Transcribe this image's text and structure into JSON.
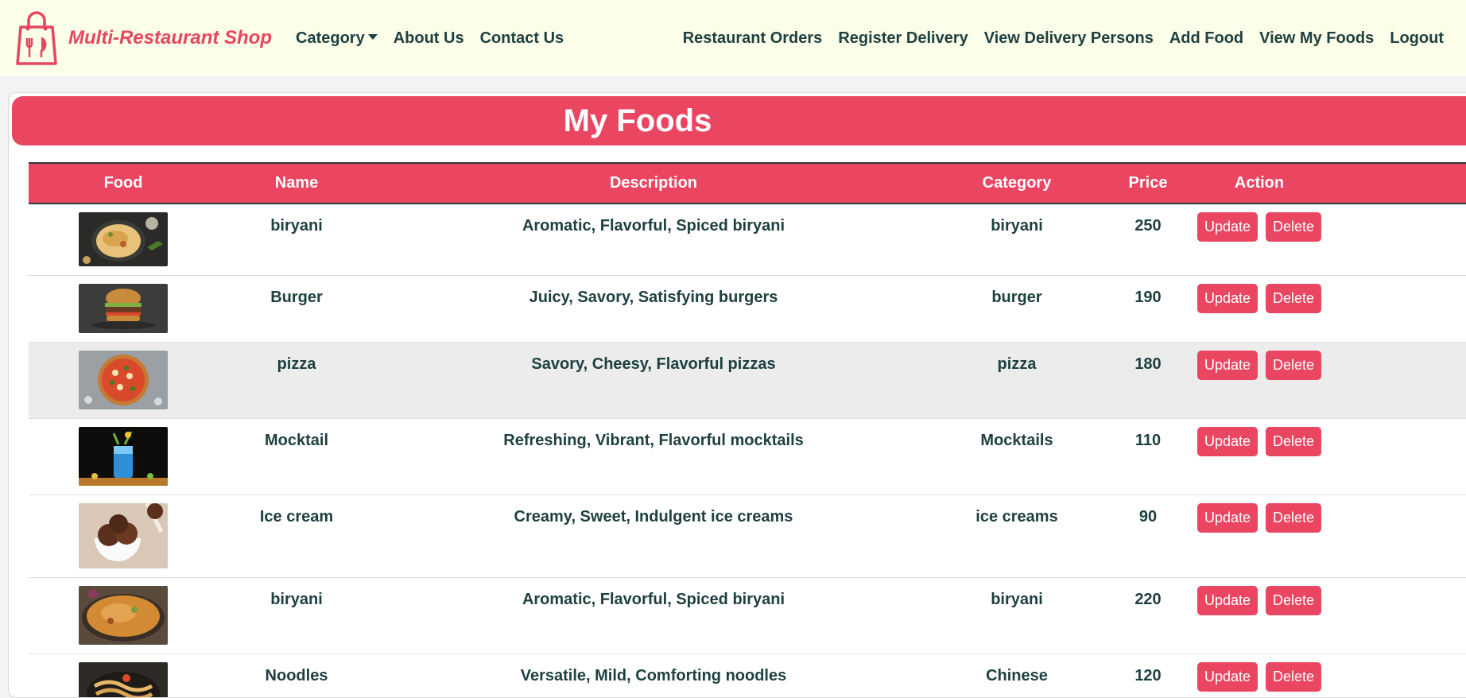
{
  "brand": {
    "name": "Multi-Restaurant Shop"
  },
  "nav": {
    "left": [
      "Category",
      "About Us",
      "Contact Us"
    ],
    "right": [
      "Restaurant Orders",
      "Register Delivery",
      "View Delivery Persons",
      "Add Food",
      "View My Foods",
      "Logout"
    ]
  },
  "page": {
    "title": "My Foods"
  },
  "table": {
    "headers": [
      "Food",
      "Name",
      "Description",
      "Category",
      "Price",
      "Action"
    ],
    "rows": [
      {
        "name": "biryani",
        "description": "Aromatic, Flavorful, Spiced biryani",
        "category": "biryani",
        "price": "250",
        "image": "biryani-image"
      },
      {
        "name": "Burger",
        "description": "Juicy, Savory, Satisfying burgers",
        "category": "burger",
        "price": "190",
        "image": "burger-image"
      },
      {
        "name": "pizza",
        "description": "Savory, Cheesy, Flavorful pizzas",
        "category": "pizza",
        "price": "180",
        "image": "pizza-image"
      },
      {
        "name": "Mocktail",
        "description": "Refreshing, Vibrant, Flavorful mocktails",
        "category": "Mocktails",
        "price": "110",
        "image": "mocktail-image"
      },
      {
        "name": "Ice cream",
        "description": "Creamy, Sweet, Indulgent ice creams",
        "category": "ice creams",
        "price": "90",
        "image": "ice-cream-image"
      },
      {
        "name": "biryani",
        "description": "Aromatic, Flavorful, Spiced biryani",
        "category": "biryani",
        "price": "220",
        "image": "biryani-image"
      },
      {
        "name": "Noodles",
        "description": "Versatile, Mild, Comforting noodles",
        "category": "Chinese",
        "price": "120",
        "image": "noodles-image"
      }
    ],
    "actions": {
      "update": "Update",
      "delete": "Delete"
    }
  },
  "colors": {
    "accent": "#ea4561",
    "navbar_bg": "#fbfee8",
    "text": "#1f4040",
    "highlight_row": "#ececec"
  }
}
